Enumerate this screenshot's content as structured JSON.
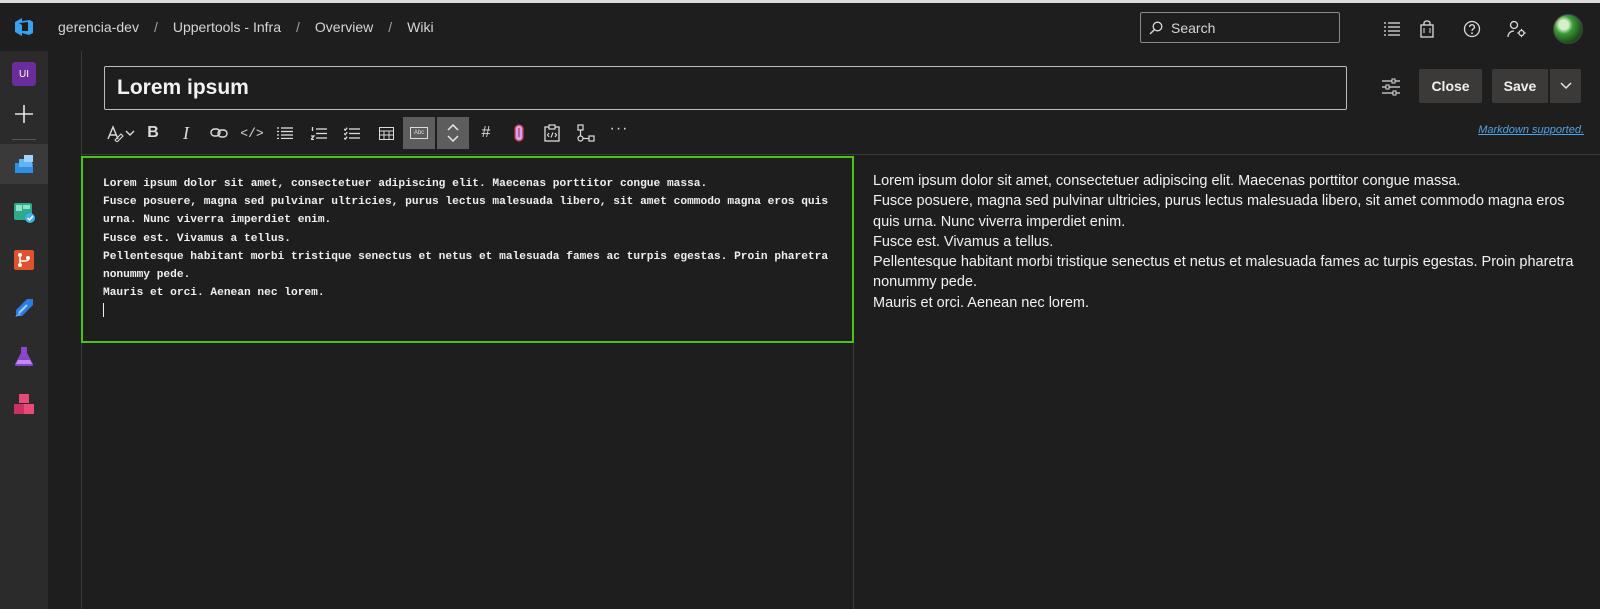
{
  "breadcrumbs": [
    "gerencia-dev",
    "Uppertools - Infra",
    "Overview",
    "Wiki"
  ],
  "search": {
    "placeholder": "Search"
  },
  "leftnav": {
    "project_badge": "UI"
  },
  "page": {
    "title_value": "Lorem ipsum",
    "close_label": "Close",
    "save_label": "Save",
    "markdown_link": "Markdown supported.",
    "abc_label": "Abc"
  },
  "editor_lines": [
    "Lorem ipsum dolor sit amet, consectetuer adipiscing elit. Maecenas porttitor congue massa.",
    "Fusce posuere, magna sed pulvinar ultricies, purus lectus malesuada libero, sit amet commodo magna eros quis urna. Nunc viverra imperdiet enim.",
    "Fusce est. Vivamus a tellus.",
    "Pellentesque habitant morbi tristique senectus et netus et malesuada fames ac turpis egestas. Proin pharetra nonummy pede.",
    "Mauris et orci. Aenean nec lorem."
  ],
  "preview_lines": [
    "Lorem ipsum dolor sit amet, consectetuer adipiscing elit. Maecenas porttitor congue massa.",
    "Fusce posuere, magna sed pulvinar ultricies, purus lectus malesuada libero, sit amet commodo magna eros quis urna. Nunc viverra imperdiet enim.",
    "Fusce est. Vivamus a tellus.",
    "Pellentesque habitant morbi tristique senectus et netus et malesuada fames ac turpis egestas. Proin pharetra nonummy pede.",
    "Mauris et orci. Aenean nec lorem."
  ],
  "colors": {
    "accent_blue": "#3aa0f3",
    "editor_focus_border": "#4cc417",
    "link": "#4fa3e8",
    "background": "#1f1e1e"
  },
  "icons": {
    "toolbar": [
      "text-format-icon",
      "bold-icon",
      "italic-icon",
      "link-icon",
      "code-icon",
      "bulleted-list-icon",
      "numbered-list-icon",
      "checklist-icon",
      "table-icon",
      "spell-check-icon",
      "sync-scroll-icon",
      "heading-icon",
      "attachment-icon",
      "insert-template-icon",
      "mermaid-diagram-icon",
      "more-icon"
    ],
    "topbar": [
      "task-list-icon",
      "marketplace-bag-icon",
      "help-icon",
      "user-settings-icon"
    ]
  }
}
